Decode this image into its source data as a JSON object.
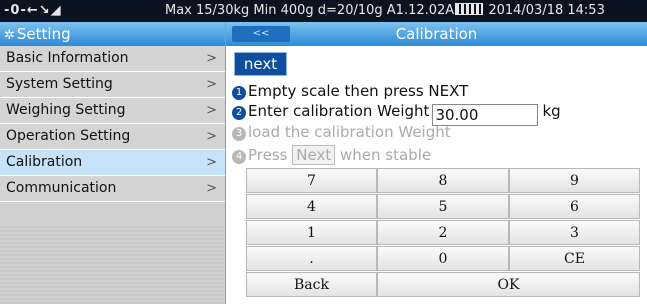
{
  "statusbar": {
    "left_icons": "-0-←↘◢",
    "info_before": "Max 15/30kg  Min 400g  d=20/10g   A1.12.02A",
    "info_after": " 2014/03/18  14:53"
  },
  "sidebar": {
    "title": "Setting",
    "items": [
      {
        "label": "Basic Information"
      },
      {
        "label": "System Setting"
      },
      {
        "label": "Weighing Setting"
      },
      {
        "label": "Operation Setting"
      },
      {
        "label": "Calibration"
      },
      {
        "label": "Communication"
      }
    ],
    "active_index": 4
  },
  "main": {
    "back_label": "<<",
    "title": "Calibration",
    "next_label": "next",
    "steps": {
      "s1_num": "1",
      "s1_text": "Empty scale then press NEXT",
      "s2_num": "2",
      "s2_text": "Enter  calibration Weight",
      "weight_value": "30.00",
      "unit": "kg",
      "s3_num": "3",
      "s3_text": "load the calibration Weight",
      "s4_num": "4",
      "s4_before": "Press",
      "s4_button": "Next",
      "s4_after": "when stable"
    }
  },
  "keypad": {
    "k7": "7",
    "k8": "8",
    "k9": "9",
    "k4": "4",
    "k5": "5",
    "k6": "6",
    "k1": "1",
    "k2": "2",
    "k3": "3",
    "kdot": ".",
    "k0": "0",
    "kce": "CE",
    "kback": "Back",
    "kok": "OK"
  }
}
